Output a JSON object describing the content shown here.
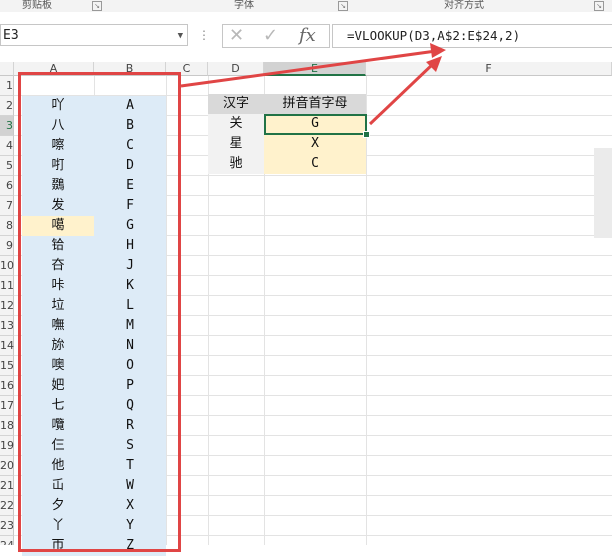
{
  "ribbon": {
    "group_clipboard": "剪贴板",
    "group_font": "字体",
    "group_alignment": "对齐方式"
  },
  "formula_bar": {
    "name_box": "E3",
    "formula": "=VLOOKUP(D3,A$2:E$24,2)"
  },
  "columns": [
    "A",
    "B",
    "C",
    "D",
    "E",
    "F"
  ],
  "selected_column": "E",
  "rows": [
    "1",
    "2",
    "3",
    "4",
    "5",
    "6",
    "7",
    "8",
    "9",
    "10",
    "11",
    "12",
    "13",
    "14",
    "15",
    "16",
    "17",
    "18",
    "19",
    "20",
    "21",
    "22",
    "23",
    "24"
  ],
  "selected_row": "3",
  "table_left": {
    "col_a": [
      "吖",
      "八",
      "嚓",
      "咑",
      "鵽",
      "发",
      "噶",
      "铪",
      "夻",
      "咔",
      "垃",
      "嘸",
      "旀",
      "噢",
      "妑",
      "七",
      "囕",
      "仨",
      "他",
      "屲",
      "夕",
      "丫",
      "帀"
    ],
    "col_b": [
      "A",
      "B",
      "C",
      "D",
      "E",
      "F",
      "G",
      "H",
      "J",
      "K",
      "L",
      "M",
      "N",
      "O",
      "P",
      "Q",
      "R",
      "S",
      "T",
      "W",
      "X",
      "Y",
      "Z"
    ],
    "highlighted_row_index": 6
  },
  "lookup": {
    "header_d": "汉字",
    "header_e": "拼音首字母",
    "rows": [
      {
        "d": "关",
        "e": "G"
      },
      {
        "d": "星",
        "e": "X"
      },
      {
        "d": "驰",
        "e": "C"
      }
    ]
  },
  "colors": {
    "accent_green": "#217346",
    "annotation_red": "#e04545",
    "range_blue": "#ddebf7",
    "highlight_yellow": "#fff2cc"
  }
}
